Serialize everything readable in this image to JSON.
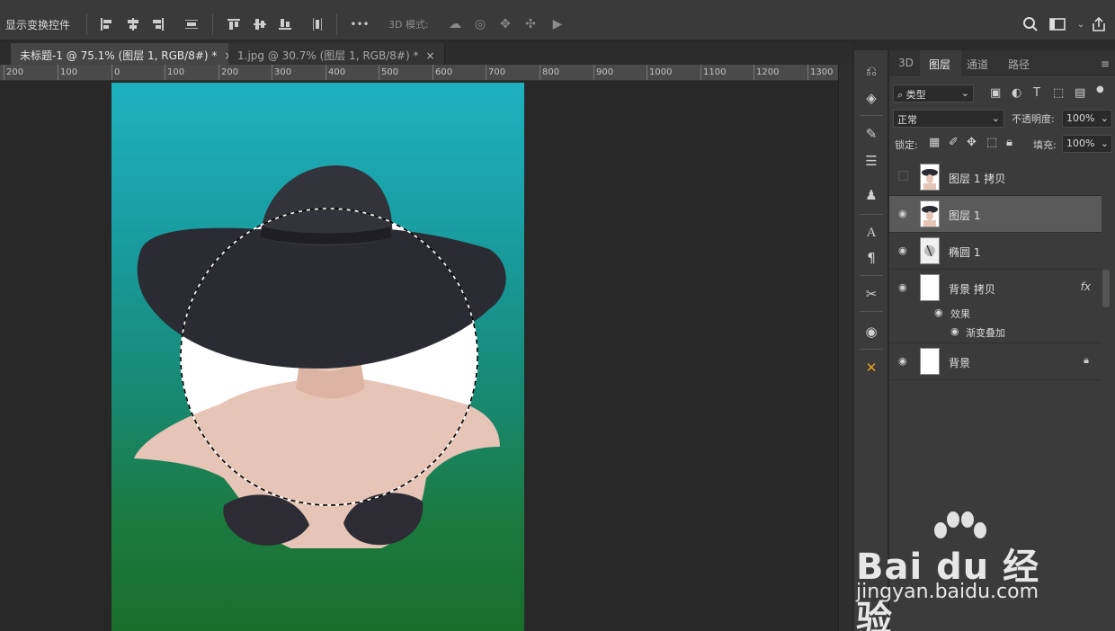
{
  "options_bar": {
    "show_transform_controls": "显示变换控件",
    "mode_3d_label": "3D 模式:",
    "more_label": "•••"
  },
  "tabs": [
    {
      "label": "未标题-1 @ 75.1% (图层 1, RGB/8#) *",
      "close": "×"
    },
    {
      "label": "1.jpg @ 30.7% (图层 1, RGB/8#) *",
      "close": "×"
    }
  ],
  "ruler": {
    "ticks": [
      "200",
      "100",
      "0",
      "100",
      "200",
      "300",
      "400",
      "500",
      "600",
      "700",
      "800",
      "900",
      "1000",
      "1100",
      "1200",
      "1300"
    ]
  },
  "layers_panel": {
    "tabs": [
      "3D",
      "图层",
      "通道",
      "路径"
    ],
    "filter_type": "类型",
    "blend_mode": "正常",
    "opacity_label": "不透明度:",
    "opacity_value": "100%",
    "lock_label": "锁定:",
    "fill_label": "填充:",
    "fill_value": "100%",
    "layers": [
      {
        "name": "图层 1 拷贝",
        "visible": false,
        "selected": false
      },
      {
        "name": "图层 1",
        "visible": true,
        "selected": true
      },
      {
        "name": "椭圆 1",
        "visible": true,
        "selected": false
      },
      {
        "name": "背景 拷贝",
        "visible": true,
        "selected": false,
        "fx": "fx"
      },
      {
        "name": "背景",
        "visible": true,
        "selected": false,
        "locked": true
      }
    ],
    "effects_label": "效果",
    "gradient_overlay_label": "渐变叠加"
  },
  "watermark": {
    "brand": "Bai du 经验",
    "url": "jingyan.baidu.com"
  },
  "colors": {
    "panel_bg": "#3b3b3b",
    "canvas_bg": "#282828",
    "selected_layer": "#5a5a5a",
    "lips": "#c8141c",
    "hat": "#2b2b33"
  }
}
